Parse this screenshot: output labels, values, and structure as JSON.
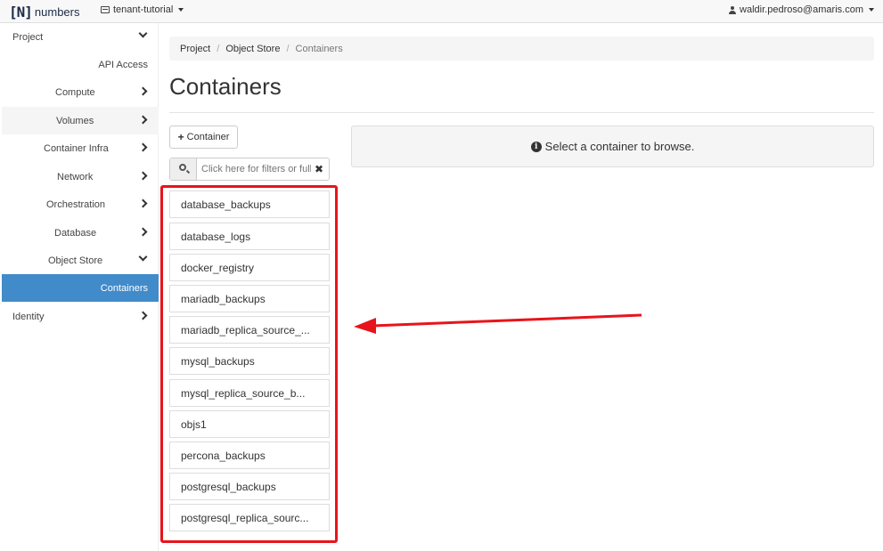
{
  "topbar": {
    "logo_bracket": "[N]",
    "logo_text": "numbers",
    "project": "tenant-tutorial",
    "user": "waldir.pedroso@amaris.com"
  },
  "sidebar": {
    "items": [
      {
        "label": "Project",
        "chevron": "down"
      },
      {
        "label": "API Access",
        "chevron": "none"
      },
      {
        "label": "Compute",
        "chevron": "right"
      },
      {
        "label": "Volumes",
        "chevron": "right"
      },
      {
        "label": "Container Infra",
        "chevron": "right"
      },
      {
        "label": "Network",
        "chevron": "right"
      },
      {
        "label": "Orchestration",
        "chevron": "right"
      },
      {
        "label": "Database",
        "chevron": "right"
      },
      {
        "label": "Object Store",
        "chevron": "down"
      },
      {
        "label": "Containers",
        "chevron": "none"
      },
      {
        "label": "Identity",
        "chevron": "right"
      }
    ]
  },
  "breadcrumb": {
    "items": [
      "Project",
      "Object Store",
      "Containers"
    ],
    "separator": "/"
  },
  "page": {
    "title": "Containers",
    "add_container_label": "Container",
    "search_placeholder": "Click here for filters or full text search.",
    "info_message": "Select a container to browse."
  },
  "containers": [
    "database_backups",
    "database_logs",
    "docker_registry",
    "mariadb_backups",
    "mariadb_replica_source_...",
    "mysql_backups",
    "mysql_replica_source_b...",
    "objs1",
    "percona_backups",
    "postgresql_backups",
    "postgresql_replica_sourc..."
  ],
  "colors": {
    "accent": "#428bca",
    "annotation": "#e8141b"
  }
}
